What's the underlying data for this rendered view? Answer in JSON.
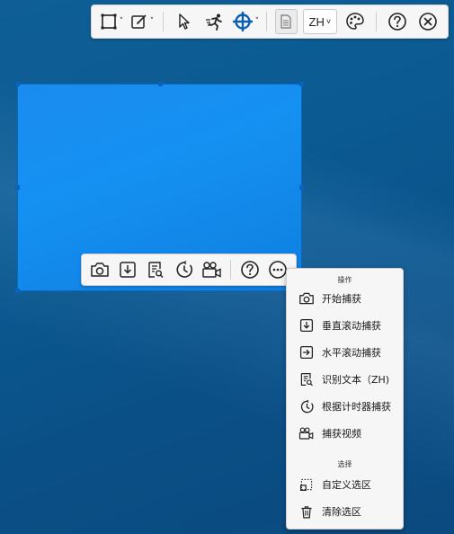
{
  "top_toolbar": {
    "lang": "ZH",
    "chevron": "˅",
    "icons": [
      "rectangle-select-icon",
      "edit-icon",
      "cursor-icon",
      "running-icon",
      "crosshair-icon",
      "document-icon",
      "palette-icon",
      "help-icon",
      "close-icon"
    ]
  },
  "bottom_toolbar": {
    "icons": [
      "camera-icon",
      "download-icon",
      "text-recognize-icon",
      "timer-icon",
      "video-camera-icon",
      "help-icon",
      "more-icon"
    ]
  },
  "menu": {
    "section1_header": "操作",
    "section2_header": "选择",
    "items": [
      {
        "label": "开始捕获",
        "icon": "camera-icon"
      },
      {
        "label": "垂直滚动捕获",
        "icon": "scroll-vertical-icon"
      },
      {
        "label": "水平滚动捕获",
        "icon": "scroll-horizontal-icon"
      },
      {
        "label": "识别文本（ZH)",
        "icon": "text-recognize-icon"
      },
      {
        "label": "根据计时器捕获",
        "icon": "timer-icon"
      },
      {
        "label": "捕获视频",
        "icon": "video-camera-icon"
      },
      {
        "label": "自定义选区",
        "icon": "custom-selection-icon"
      },
      {
        "label": "清除选区",
        "icon": "trash-icon"
      }
    ]
  },
  "colors": {
    "accent": "#0b66c2",
    "selection": "#1491f2",
    "toolbar_bg": "#f6f6f6"
  }
}
